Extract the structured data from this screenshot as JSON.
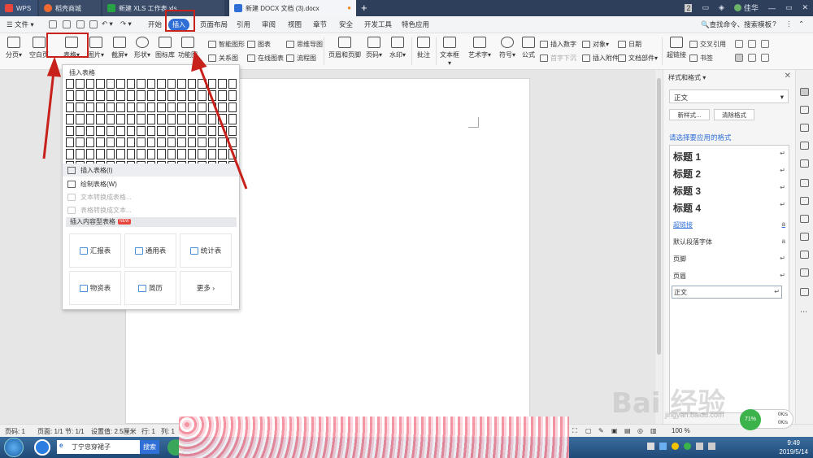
{
  "titlebar": {
    "tabs": [
      {
        "label": "WPS"
      },
      {
        "label": "稻壳商城"
      },
      {
        "label": "新建 XLS 工作表.xls"
      },
      {
        "label": "新建 DOCX 文档 (3).docx"
      }
    ],
    "badge": "2",
    "user": "佳华"
  },
  "menubar": {
    "file": "文件",
    "items": [
      "开始",
      "插入",
      "页面布局",
      "引用",
      "审阅",
      "视图",
      "章节",
      "安全",
      "开发工具",
      "特色应用"
    ],
    "search": "查找命令、搜索模板",
    "help": "?"
  },
  "ribbon": {
    "big": [
      "分页",
      "空白页",
      "表格",
      "图片",
      "截屏",
      "形状",
      "图标库",
      "功能图",
      "页眉和页脚",
      "页码",
      "水印",
      "批注",
      "文本框",
      "艺术字",
      "符号",
      "公式",
      "超链接",
      "书签"
    ],
    "small": [
      "智能图形",
      "图表",
      "思维导图",
      "关系图",
      "在线图表",
      "流程图",
      "插入数字",
      "对象",
      "日期",
      "首字下沉",
      "插入附件",
      "文档部件",
      "交叉引用"
    ]
  },
  "dropdown": {
    "title": "插入表格",
    "insert_table": "插入表格(I)",
    "draw_table": "绘制表格(W)",
    "text_to_table": "文本转换成表格...",
    "table_to_text": "表格转换成文本...",
    "content_tables": "插入内容型表格",
    "new_badge": "NEW",
    "cards": [
      "汇报表",
      "通用表",
      "统计表",
      "物资表",
      "简历",
      "更多"
    ]
  },
  "rpanel": {
    "title": "样式和格式",
    "current": "正文",
    "new_style": "新样式...",
    "clear_format": "清除格式",
    "hint": "请选择要应用的格式",
    "styles": [
      "标题 1",
      "标题 2",
      "标题 3",
      "标题 4",
      "超链接",
      "默认段落字体",
      "页脚",
      "页眉",
      "正文"
    ],
    "marks": [
      "↵",
      "↵",
      "↵",
      "↵",
      "a",
      "a",
      "↵",
      "↵",
      "↵"
    ]
  },
  "status": {
    "page": "页码: 1",
    "pages": "页面: 1/1",
    "section": "节: 1/1",
    "setting": "设置值: 2.5厘米",
    "row": "行: 1",
    "col": "列: 1",
    "zoom": "100 %",
    "speed_pct": "71%",
    "up": "0K/s",
    "down": "0K/s"
  },
  "taskbar": {
    "search": "丁宁忠穿裙子",
    "search_btn": "搜索",
    "time": "9:49",
    "date": "2019/5/14"
  },
  "watermark": {
    "text": "Bai 经验",
    "url": "jingyan.baidu.com"
  },
  "colors": {
    "accent": "#2f6fd6",
    "annotation": "#c8201a",
    "titlebar": "#2e3f5c"
  }
}
